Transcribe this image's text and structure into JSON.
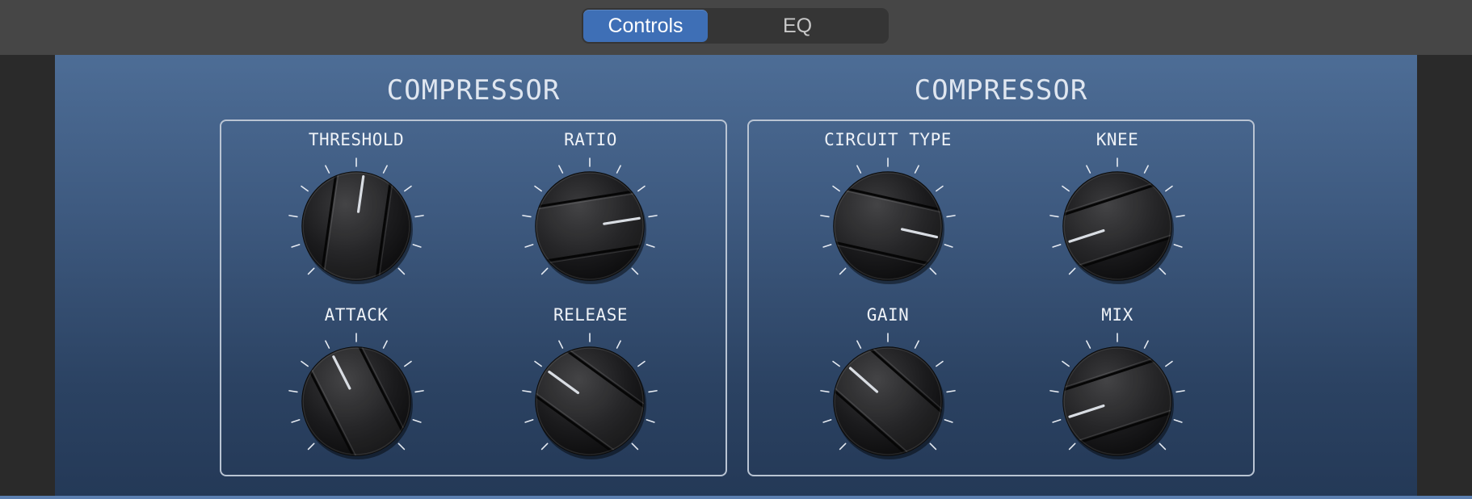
{
  "tabs": {
    "controls": "Controls",
    "eq": "EQ",
    "selected": "Controls"
  },
  "colors": {
    "accent": "#3e6fb6",
    "panel_top": "#4d6d96",
    "panel_bottom": "#243957"
  },
  "sections": [
    {
      "title": "COMPRESSOR",
      "knobs": [
        {
          "label": "THRESHOLD",
          "value": 0.53
        },
        {
          "label": "RATIO",
          "value": 0.8
        },
        {
          "label": "ATTACK",
          "value": 0.4
        },
        {
          "label": "RELEASE",
          "value": 0.3
        }
      ]
    },
    {
      "title": "COMPRESSOR",
      "knobs": [
        {
          "label": "CIRCUIT TYPE",
          "value": 0.88
        },
        {
          "label": "KNEE",
          "value": 0.1
        },
        {
          "label": "GAIN",
          "value": 0.32
        },
        {
          "label": "MIX",
          "value": 0.1
        }
      ]
    }
  ]
}
